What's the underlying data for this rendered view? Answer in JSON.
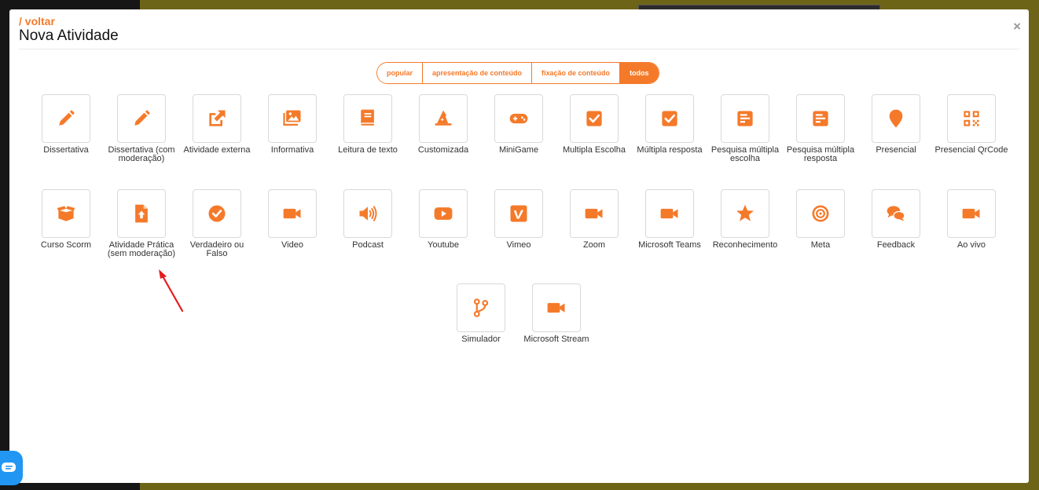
{
  "header": {
    "back_label": "/ voltar",
    "title": "Nova Atividade",
    "close_label": "×"
  },
  "filters": {
    "tabs": [
      {
        "label": "popular",
        "active": false
      },
      {
        "label": "apresentação de conteúdo",
        "active": false
      },
      {
        "label": "fixação de conteúdo",
        "active": false
      },
      {
        "label": "todos",
        "active": true
      }
    ]
  },
  "activities": [
    {
      "label": "Dissertativa",
      "icon": "pencil-icon"
    },
    {
      "label": "Dissertativa (com moderação)",
      "icon": "pencil-icon"
    },
    {
      "label": "Atividade externa",
      "icon": "external-link-icon"
    },
    {
      "label": "Informativa",
      "icon": "images-icon"
    },
    {
      "label": "Leitura de texto",
      "icon": "book-icon"
    },
    {
      "label": "Customizada",
      "icon": "wizard-hat-icon"
    },
    {
      "label": "MiniGame",
      "icon": "gamepad-icon"
    },
    {
      "label": "Multipla Escolha",
      "icon": "checkbox-icon"
    },
    {
      "label": "Múltipla resposta",
      "icon": "checkbox-icon"
    },
    {
      "label": "Pesquisa múltipla escolha",
      "icon": "poll-icon"
    },
    {
      "label": "Pesquisa múltipla resposta",
      "icon": "poll-icon"
    },
    {
      "label": "Presencial",
      "icon": "map-marker-icon"
    },
    {
      "label": "Presencial QrCode",
      "icon": "qrcode-icon"
    },
    {
      "label": "Curso Scorm",
      "icon": "box-open-icon"
    },
    {
      "label": "Atividade Prática (sem moderação)",
      "icon": "file-upload-icon"
    },
    {
      "label": "Verdadeiro ou Falso",
      "icon": "check-circle-icon"
    },
    {
      "label": "Video",
      "icon": "video-icon"
    },
    {
      "label": "Podcast",
      "icon": "volume-icon"
    },
    {
      "label": "Youtube",
      "icon": "youtube-icon"
    },
    {
      "label": "Vimeo",
      "icon": "vimeo-icon"
    },
    {
      "label": "Zoom",
      "icon": "video-icon"
    },
    {
      "label": "Microsoft Teams",
      "icon": "video-icon"
    },
    {
      "label": "Reconhecimento",
      "icon": "star-icon"
    },
    {
      "label": "Meta",
      "icon": "bullseye-icon"
    },
    {
      "label": "Feedback",
      "icon": "comments-icon"
    },
    {
      "label": "Ao vivo",
      "icon": "video-icon"
    },
    {
      "label": "Simulador",
      "icon": "code-branch-icon"
    },
    {
      "label": "Microsoft Stream",
      "icon": "video-icon"
    }
  ],
  "colors": {
    "accent": "#f47a2a",
    "chat": "#2196f3"
  }
}
